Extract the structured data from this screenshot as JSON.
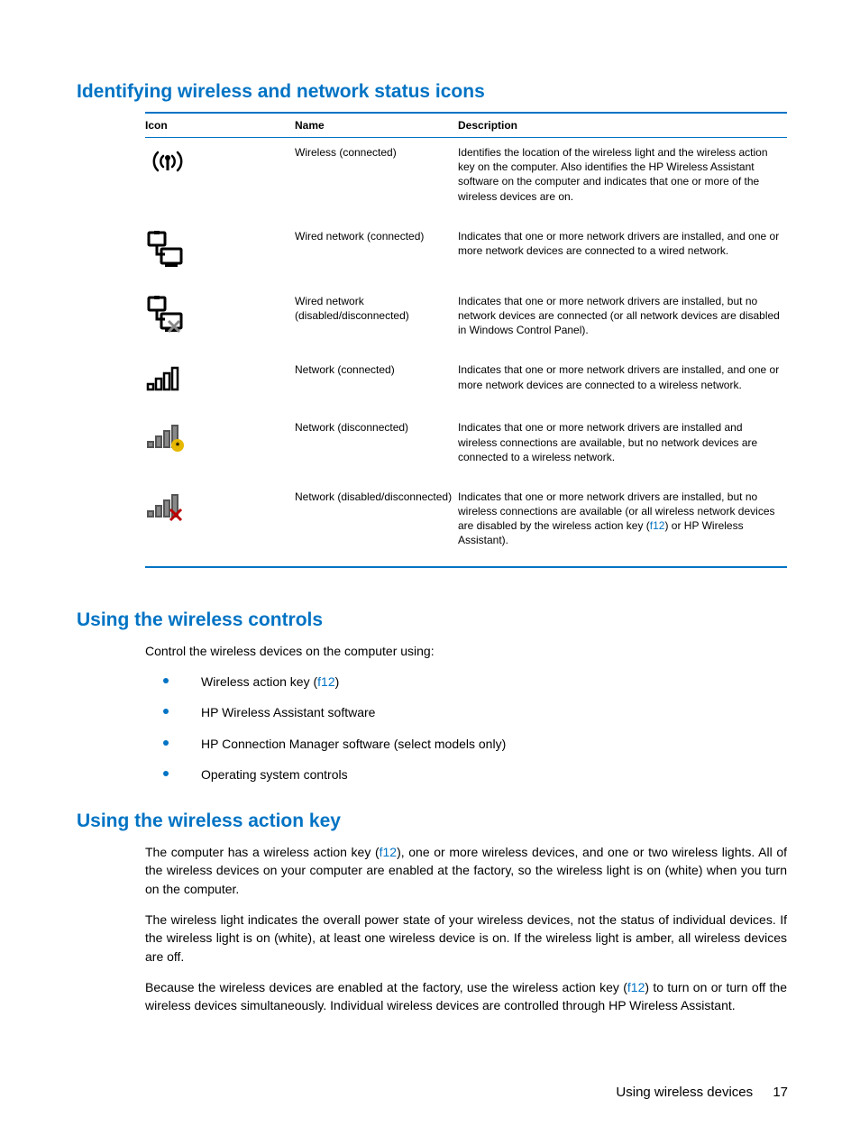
{
  "section1_title": "Identifying wireless and network status icons",
  "table": {
    "headers": {
      "icon": "Icon",
      "name": "Name",
      "desc": "Description"
    },
    "rows": [
      {
        "name": "Wireless (connected)",
        "desc": "Identifies the location of the wireless light and the wireless action key on the computer. Also identifies the HP Wireless Assistant software on the computer and indicates that one or more of the wireless devices are on."
      },
      {
        "name": "Wired network (connected)",
        "desc": "Indicates that one or more network drivers are installed, and one or more network devices are connected to a wired network."
      },
      {
        "name": "Wired network (disabled/disconnected)",
        "desc": "Indicates that one or more network drivers are installed, but no network devices are connected (or all network devices are disabled in Windows Control Panel)."
      },
      {
        "name": "Network (connected)",
        "desc": "Indicates that one or more network drivers are installed, and one or more network devices are connected to a wireless network."
      },
      {
        "name": "Network (disconnected)",
        "desc": "Indicates that one or more network drivers are installed and wireless connections are available, but no network devices are connected to a wireless network."
      },
      {
        "name": "Network (disabled/disconnected)",
        "desc_pre": "Indicates that one or more network drivers are installed, but no wireless connections are available (or all wireless network devices are disabled by the wireless action key (",
        "desc_link": "f12",
        "desc_post": ") or HP Wireless Assistant)."
      }
    ]
  },
  "section2_title": "Using the wireless controls",
  "section2_intro": "Control the wireless devices on the computer using:",
  "section2_bullets": {
    "b1_pre": "Wireless action key (",
    "b1_link": "f12",
    "b1_post": ")",
    "b2": "HP Wireless Assistant software",
    "b3": "HP Connection Manager software (select models only)",
    "b4": "Operating system controls"
  },
  "section3_title": "Using the wireless action key",
  "section3": {
    "p1_pre": "The computer has a wireless action key (",
    "p1_link": "f12",
    "p1_post": "), one or more wireless devices, and one or two wireless lights. All of the wireless devices on your computer are enabled at the factory, so the wireless light is on (white) when you turn on the computer.",
    "p2": "The wireless light indicates the overall power state of your wireless devices, not the status of individual devices. If the wireless light is on (white), at least one wireless device is on. If the wireless light is amber, all wireless devices are off.",
    "p3_pre": "Because the wireless devices are enabled at the factory, use the wireless action key (",
    "p3_link": "f12",
    "p3_post": ") to turn on or turn off the wireless devices simultaneously. Individual wireless devices are controlled through HP Wireless Assistant."
  },
  "footer_text": "Using wireless devices",
  "page_number": "17"
}
